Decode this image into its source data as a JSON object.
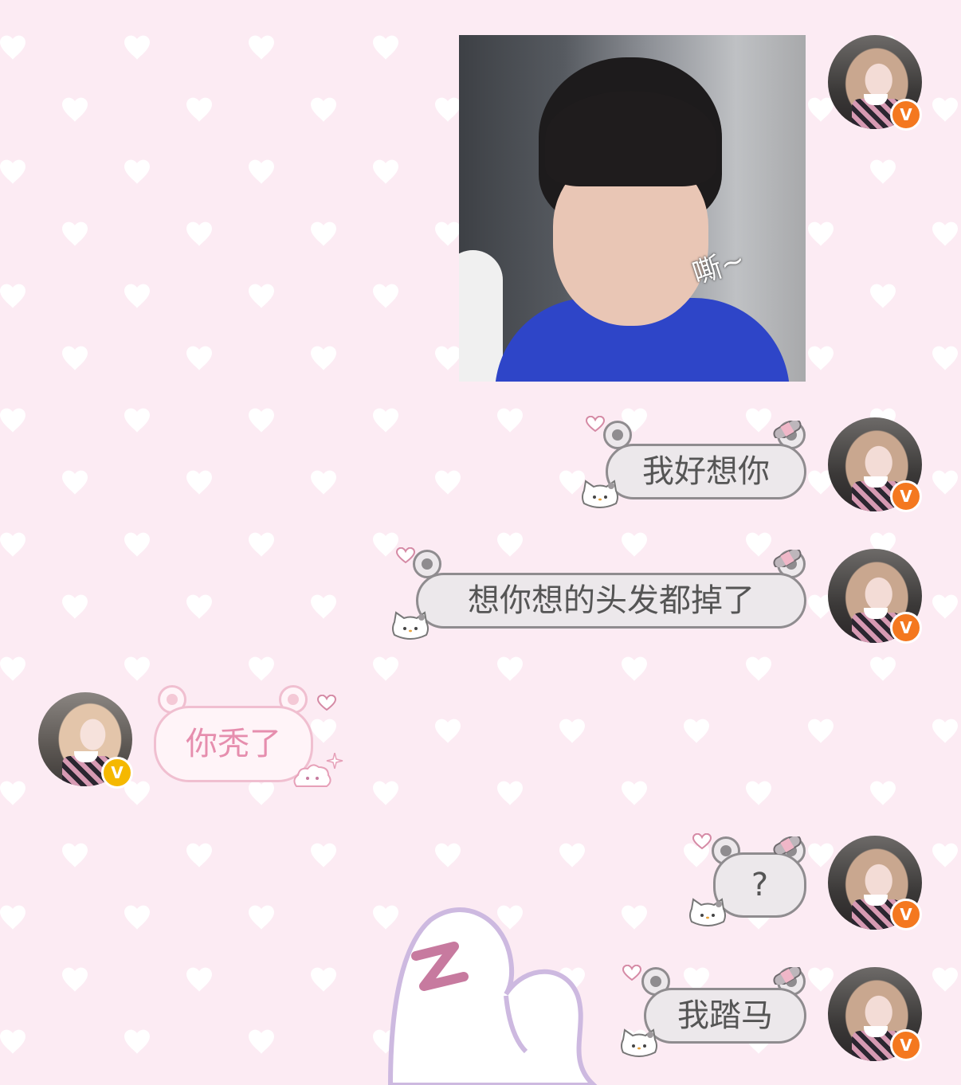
{
  "chat": {
    "image_message": {
      "caption": "嘶~"
    },
    "messages": [
      {
        "side": "right",
        "text": "我好想你"
      },
      {
        "side": "right",
        "text": "想你想的头发都掉了"
      },
      {
        "side": "left",
        "text": "你秃了"
      },
      {
        "side": "right",
        "text": "?"
      },
      {
        "side": "right",
        "text": "我踏马"
      }
    ],
    "badges": {
      "verified_mark": "V"
    }
  },
  "colors": {
    "background": "#fcebf3",
    "heart_pattern": "#ffffff",
    "outgoing_bubble": "#ece8eb",
    "outgoing_border": "#8f8c8f",
    "incoming_bubble": "#fff4f8",
    "incoming_text": "#e68eae",
    "badge_orange": "#f4781f",
    "badge_gold": "#f5b800"
  }
}
